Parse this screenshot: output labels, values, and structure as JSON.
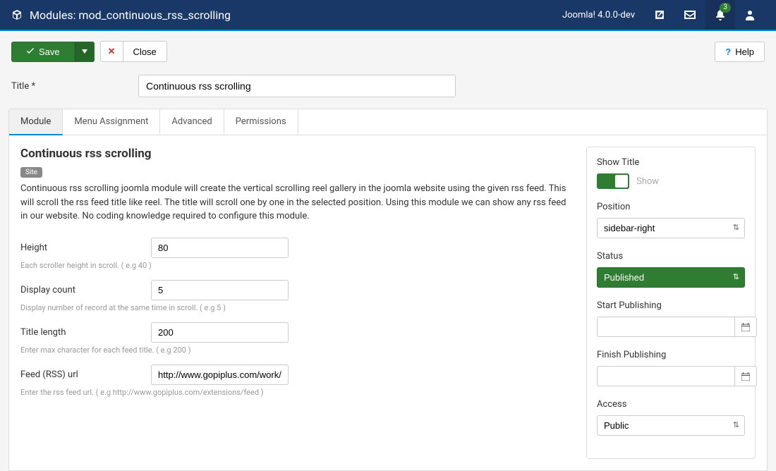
{
  "header": {
    "title": "Modules: mod_continuous_rss_scrolling",
    "version": "Joomla! 4.0.0-dev",
    "notification_count": "3"
  },
  "toolbar": {
    "save_label": "Save",
    "close_label": "Close",
    "help_label": "Help"
  },
  "title_field": {
    "label": "Title *",
    "value": "Continuous rss scrolling"
  },
  "tabs": [
    {
      "label": "Module"
    },
    {
      "label": "Menu Assignment"
    },
    {
      "label": "Advanced"
    },
    {
      "label": "Permissions"
    }
  ],
  "module": {
    "heading": "Continuous rss scrolling",
    "badge": "Site",
    "description": "Continuous rss scrolling joomla module will create the vertical scrolling reel gallery in the joomla website using the given rss feed. This will scroll the rss feed title like reel. The title will scroll one by one in the selected position. Using this module we can show any rss feed in our website. No coding knowledge required to configure this module.",
    "fields": [
      {
        "label": "Height",
        "value": "80",
        "hint": "Each scroller height in scroll. ( e.g 40 )"
      },
      {
        "label": "Display count",
        "value": "5",
        "hint": "Display number of record at the same time in scroll. ( e.g 5 )"
      },
      {
        "label": "Title length",
        "value": "200",
        "hint": "Enter max character for each feed title. ( e.g 200 )"
      },
      {
        "label": "Feed (RSS) url",
        "value": "http://www.gopiplus.com/work/feed",
        "hint": "Enter the rss feed url. ( e.g http://www.gopiplus.com/extensions/feed )"
      }
    ]
  },
  "sidebar": {
    "show_title": {
      "label": "Show Title",
      "text": "Show"
    },
    "position": {
      "label": "Position",
      "value": "sidebar-right"
    },
    "status": {
      "label": "Status",
      "value": "Published"
    },
    "start_pub": {
      "label": "Start Publishing",
      "value": ""
    },
    "finish_pub": {
      "label": "Finish Publishing",
      "value": ""
    },
    "access": {
      "label": "Access",
      "value": "Public"
    }
  }
}
